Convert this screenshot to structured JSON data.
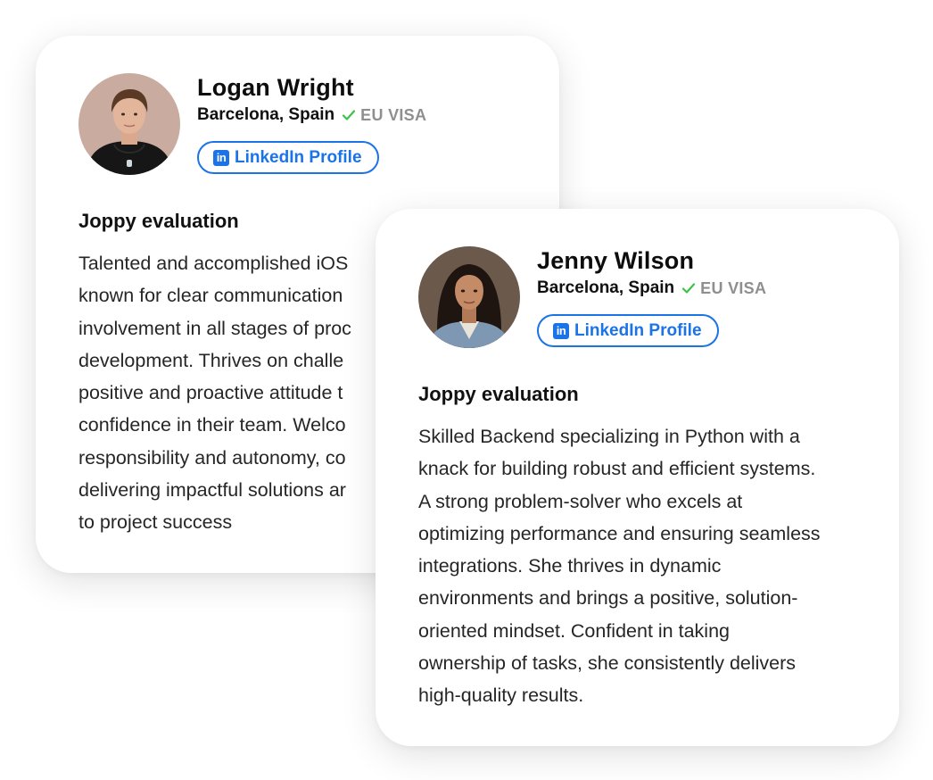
{
  "cards": [
    {
      "name": "Logan Wright",
      "location": "Barcelona, Spain",
      "visa": "EU VISA",
      "linkedin_label": "LinkedIn Profile",
      "linkedin_icon": "in",
      "evaluation_title": "Joppy evaluation",
      "evaluation_lines": [
        "Talented and accomplished iOS",
        "known for clear communication",
        "involvement in all stages of proc",
        "development. Thrives on challe",
        "positive and proactive attitude t",
        "confidence in their team. Welco",
        "responsibility and autonomy, co",
        "delivering impactful solutions ar",
        "to project success"
      ]
    },
    {
      "name": "Jenny Wilson",
      "location": "Barcelona, Spain",
      "visa": "EU VISA",
      "linkedin_label": "LinkedIn Profile",
      "linkedin_icon": "in",
      "evaluation_title": "Joppy evaluation",
      "evaluation_lines": [
        "Skilled Backend specializing in Python with a",
        "knack for building robust and efficient systems.",
        "A strong problem-solver who excels at",
        "optimizing performance and ensuring seamless",
        "integrations. She thrives in dynamic",
        "environments and brings a positive, solution-",
        "oriented mindset. Confident in taking",
        "ownership of tasks, she consistently delivers",
        "high-quality results."
      ]
    }
  ],
  "colors": {
    "accent_blue": "#1b73e8",
    "check_green": "#3cc24a",
    "visa_gray": "#8f8f8f"
  },
  "icons": {
    "check": "check-icon",
    "linkedin": "linkedin-icon"
  }
}
